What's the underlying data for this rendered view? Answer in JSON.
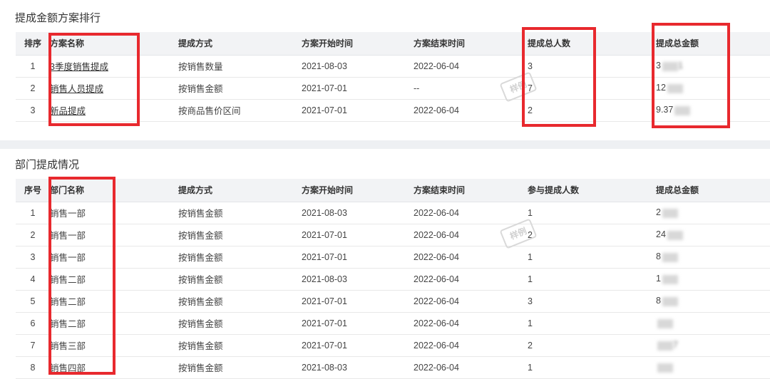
{
  "scheme_ranking": {
    "title": "提成金额方案排行",
    "headers": [
      "排序",
      "方案名称",
      "提成方式",
      "方案开始时间",
      "方案结束时间",
      "提成总人数",
      "提成总金额"
    ],
    "rows": [
      {
        "idx": "1",
        "name": "3季度销售提成",
        "method": "按销售数量",
        "start": "2021-08-03",
        "end": "2022-06-04",
        "people": "3",
        "amount_visible": "3",
        "amount_tail": "1"
      },
      {
        "idx": "2",
        "name": "销售人员提成",
        "method": "按销售金额",
        "start": "2021-07-01",
        "end": "--",
        "people": "7",
        "amount_visible": "12",
        "amount_tail": ""
      },
      {
        "idx": "3",
        "name": "新品提成",
        "method": "按商品售价区间",
        "start": "2021-07-01",
        "end": "2022-06-04",
        "people": "2",
        "amount_visible": "9.37",
        "amount_tail": ""
      }
    ]
  },
  "department_status": {
    "title": "部门提成情况",
    "headers": [
      "序号",
      "部门名称",
      "提成方式",
      "方案开始时间",
      "方案结束时间",
      "参与提成人数",
      "提成总金额"
    ],
    "rows": [
      {
        "idx": "1",
        "dept": "销售一部",
        "method": "按销售金额",
        "start": "2021-08-03",
        "end": "2022-06-04",
        "people": "1",
        "amount_visible": "2",
        "amount_tail": ""
      },
      {
        "idx": "2",
        "dept": "销售一部",
        "method": "按销售金额",
        "start": "2021-07-01",
        "end": "2022-06-04",
        "people": "2",
        "amount_visible": "24",
        "amount_tail": ""
      },
      {
        "idx": "3",
        "dept": "销售一部",
        "method": "按销售金额",
        "start": "2021-07-01",
        "end": "2022-06-04",
        "people": "1",
        "amount_visible": "8",
        "amount_tail": ""
      },
      {
        "idx": "4",
        "dept": "销售二部",
        "method": "按销售金额",
        "start": "2021-08-03",
        "end": "2022-06-04",
        "people": "1",
        "amount_visible": "1",
        "amount_tail": ""
      },
      {
        "idx": "5",
        "dept": "销售二部",
        "method": "按销售金额",
        "start": "2021-07-01",
        "end": "2022-06-04",
        "people": "3",
        "amount_visible": "8",
        "amount_tail": ""
      },
      {
        "idx": "6",
        "dept": "销售二部",
        "method": "按销售金额",
        "start": "2021-07-01",
        "end": "2022-06-04",
        "people": "1",
        "amount_visible": "",
        "amount_tail": ""
      },
      {
        "idx": "7",
        "dept": "销售三部",
        "method": "按销售金额",
        "start": "2021-07-01",
        "end": "2022-06-04",
        "people": "2",
        "amount_visible": "",
        "amount_tail": "7"
      },
      {
        "idx": "8",
        "dept": "销售四部",
        "method": "按销售金额",
        "start": "2021-08-03",
        "end": "2022-06-04",
        "people": "1",
        "amount_visible": "",
        "amount_tail": ""
      }
    ]
  },
  "watermark_text": "样例",
  "colors": {
    "highlight": "#e8292e",
    "header_bg": "#f2f3f5",
    "divider": "#eef0f3"
  }
}
